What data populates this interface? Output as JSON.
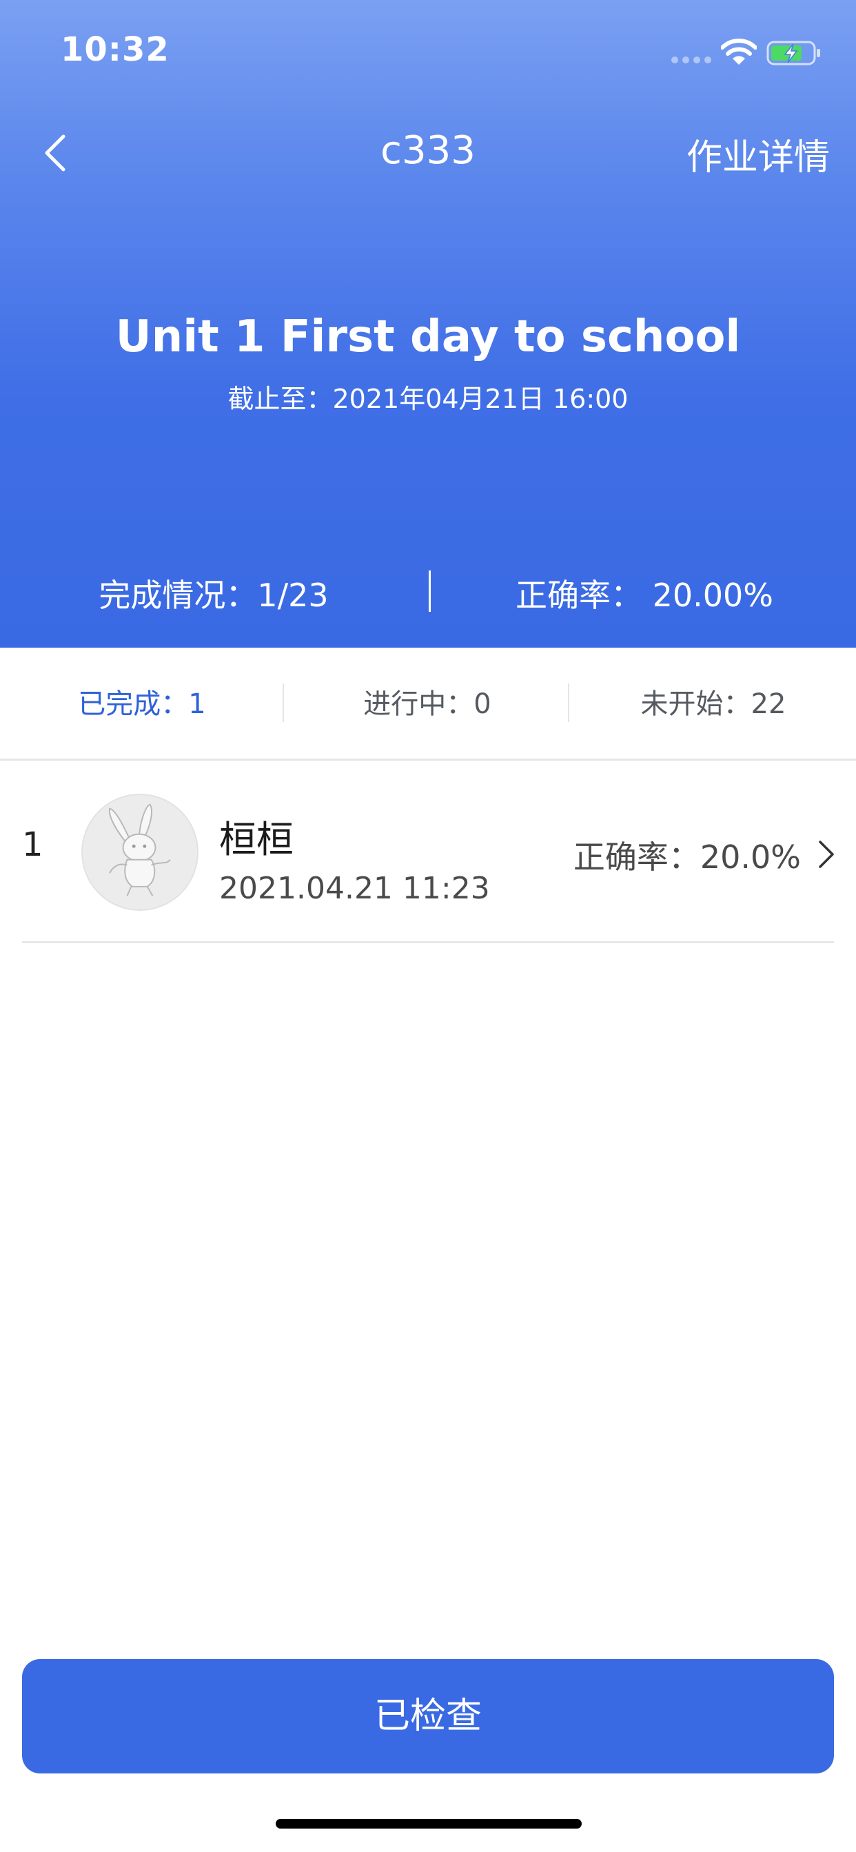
{
  "status_bar": {
    "time": "10:32"
  },
  "nav": {
    "title": "c333",
    "right_label": "作业详情"
  },
  "homework": {
    "title": "Unit 1 First day to school",
    "deadline": "截止至：2021年04月21日 16:00"
  },
  "summary": {
    "completion": "完成情况：1/23",
    "accuracy": "正确率： 20.00%"
  },
  "tabs": [
    {
      "label": "已完成：1",
      "active": true
    },
    {
      "label": "进行中：0",
      "active": false
    },
    {
      "label": "未开始：22",
      "active": false
    }
  ],
  "students": [
    {
      "index": "1",
      "name": "桓桓",
      "time": "2021.04.21 11:23",
      "accuracy": "正确率：20.0%"
    }
  ],
  "footer": {
    "button_label": "已检查"
  },
  "colors": {
    "primary": "#3a6ae3",
    "active_tab": "#2f62d8",
    "header_top": "#7aa0f2"
  },
  "icons": [
    "back-arrow-icon",
    "wifi-icon",
    "battery-charging-icon",
    "chevron-right-icon",
    "rabbit-avatar"
  ]
}
